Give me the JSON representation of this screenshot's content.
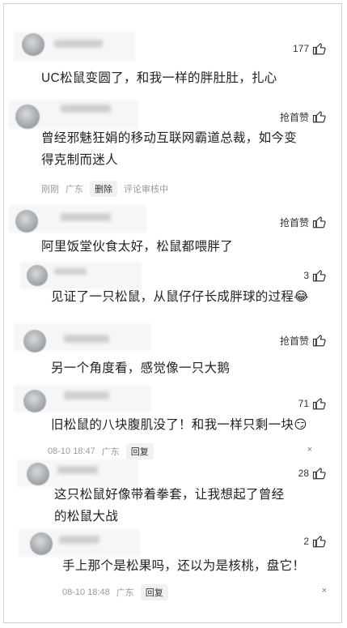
{
  "comments": [
    {
      "text": "UC松鼠变圆了，和我一样的胖肚肚，扎心",
      "likes": "177"
    },
    {
      "text": "曾经邪魅狂娟的移动互联网霸道总裁，如今变得克制而迷人",
      "likes": "抢首赞",
      "time": "刚刚",
      "location": "广东",
      "action": "删除",
      "status": "评论审核中"
    },
    {
      "text": "阿里饭堂伙食太好，松鼠都喂胖了",
      "likes": "抢首赞"
    },
    {
      "text": "见证了一只松鼠，从鼠仔仔长成胖球的过程😂",
      "likes": "3"
    },
    {
      "text": "另一个角度看，感觉像一只大鹅",
      "likes": "抢首赞"
    },
    {
      "text": "旧松鼠的八块腹肌没了！和我一样只剩一块😏",
      "likes": "71",
      "time": "08-10 18:47",
      "location": "广东",
      "action": "回复",
      "close": "×"
    },
    {
      "text": "这只松鼠好像带着拳套，让我想起了曾经的松鼠大战",
      "likes": "28"
    },
    {
      "text": "手上那个是松果吗，还以为是核桃，盘它！",
      "likes": "2",
      "time": "08-10 18:48",
      "location": "广东",
      "action": "回复",
      "close": "×"
    }
  ]
}
